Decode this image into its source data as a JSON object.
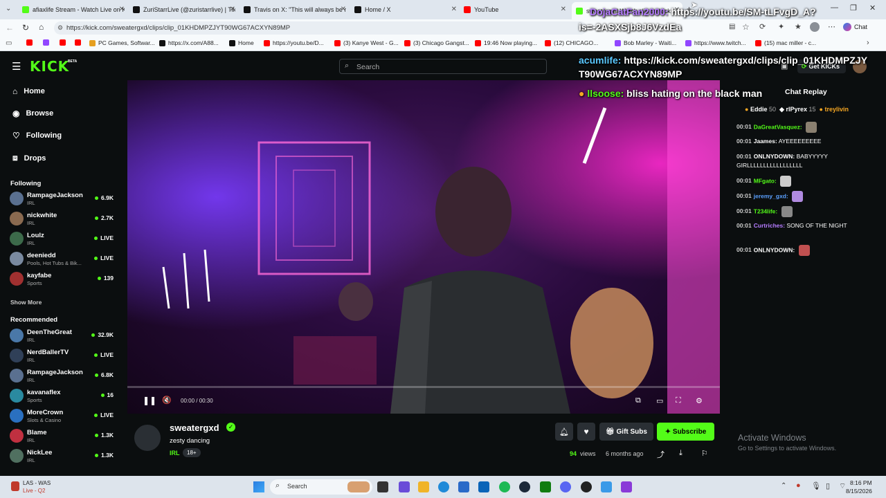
{
  "browser": {
    "tabs": [
      {
        "label": "afiaxlife Stream - Watch Live on K",
        "color": "#53fc18"
      },
      {
        "label": "ZuriStarrLive (@zuristarrlive) | TikTo",
        "color": "#111111"
      },
      {
        "label": "Travis on X: \"This will always be my",
        "color": "#111111"
      },
      {
        "label": "Home / X",
        "color": "#111111"
      },
      {
        "label": "YouTube",
        "color": "#ff0000"
      },
      {
        "label": "sweatergxd Watch clip on Kick",
        "color": "#53fc18"
      }
    ],
    "url": "https://kick.com/sweatergxd/clips/clip_01KHDMPZJYT90WG67ACXYN89MP",
    "copilot_label": "Chat",
    "bookmarks": [
      {
        "label": "",
        "color": "#ff0000"
      },
      {
        "label": "",
        "color": "#9146ff"
      },
      {
        "label": "",
        "color": "#ff0000"
      },
      {
        "label": "",
        "color": "#ff0000"
      },
      {
        "label": "PC Games, Softwar...",
        "color": "#e6a020"
      },
      {
        "label": "https://x.com/A88...",
        "color": "#111111"
      },
      {
        "label": "Home",
        "color": "#111111"
      },
      {
        "label": "https://youtu.be/D...",
        "color": "#ff0000"
      },
      {
        "label": "(3) Kanye West - G...",
        "color": "#ff0000"
      },
      {
        "label": "(3) Chicago Gangst...",
        "color": "#ff0000"
      },
      {
        "label": "19:46 Now playing...",
        "color": "#ff0000"
      },
      {
        "label": "(12) CHICAGO...",
        "color": "#ff0000"
      },
      {
        "label": "Bob Marley - Waiti...",
        "color": "#9146ff"
      },
      {
        "label": "https://www.twitch...",
        "color": "#9146ff"
      },
      {
        "label": "(15) mac miller - c...",
        "color": "#ff0000"
      }
    ]
  },
  "kick": {
    "logo": "KICK",
    "logo_badge": "BETA",
    "search_placeholder": "Search",
    "get_kicks": "Get KICKs",
    "nav": [
      {
        "label": "Home",
        "icon": "home-icon"
      },
      {
        "label": "Browse",
        "icon": "compass-icon"
      },
      {
        "label": "Following",
        "icon": "heart-icon"
      },
      {
        "label": "Drops",
        "icon": "drops-icon"
      }
    ],
    "following_title": "Following",
    "following": [
      {
        "name": "RampageJackson",
        "category": "IRL",
        "count": "6.9K",
        "color": "#5a7090"
      },
      {
        "name": "nickwhite",
        "category": "IRL",
        "count": "2.7K",
        "color": "#8a6a50"
      },
      {
        "name": "Loulz",
        "category": "IRL",
        "count": "LIVE",
        "color": "#3c6a4a"
      },
      {
        "name": "deeniedd",
        "category": "Pools, Hot Tubs & Bik...",
        "count": "LIVE",
        "color": "#7a8aa0"
      },
      {
        "name": "kayfabe",
        "category": "Sports",
        "count": "139",
        "color": "#a03030"
      }
    ],
    "show_more": "Show More",
    "recommended_title": "Recommended",
    "recommended": [
      {
        "name": "DeenTheGreat",
        "category": "IRL",
        "count": "32.9K",
        "color": "#4a78a8"
      },
      {
        "name": "NerdBallerTV",
        "category": "IRL",
        "count": "LIVE",
        "color": "#304058"
      },
      {
        "name": "RampageJackson",
        "category": "IRL",
        "count": "6.8K",
        "color": "#5a7090"
      },
      {
        "name": "kavanaflex",
        "category": "Sports",
        "count": "16",
        "color": "#2a8aa0"
      },
      {
        "name": "MoreCrown",
        "category": "Slots & Casino",
        "count": "LIVE",
        "color": "#2a70c0"
      },
      {
        "name": "Blame",
        "category": "IRL",
        "count": "1.3K",
        "color": "#c03040"
      },
      {
        "name": "NickLee",
        "category": "IRL",
        "count": "1.3K",
        "color": "#507060"
      }
    ],
    "player": {
      "time": "00:00 / 00:30",
      "progress": 0.0
    },
    "clip": {
      "channel": "sweatergxd",
      "title": "zesty dancing",
      "category": "IRL",
      "rating": "18+",
      "views": "94",
      "views_label": "views",
      "age": "6 months ago",
      "gift_subs": "Gift Subs",
      "subscribe": "Subscribe"
    },
    "chat": {
      "title": "Chat Replay",
      "leaders": [
        {
          "name": "Eddie",
          "count": "50",
          "color": "#f5a623"
        },
        {
          "name": "rIPyrex",
          "count": "15",
          "color": "#ffffff"
        },
        {
          "name": "treylivin",
          "count": "",
          "color": "#f5a623"
        }
      ],
      "messages": [
        {
          "time": "00:01",
          "user": "DaGreatVasquez:",
          "color": "#53fc18",
          "text": ""
        },
        {
          "time": "00:01",
          "user": "Jaames:",
          "color": "#ffffff",
          "text": "AYEEEEEEEEE"
        },
        {
          "time": "00:01",
          "user": "ONLNYDOWN:",
          "color": "#ffffff",
          "text": "BABYYYYY GIRLLLLLLLLLLLLLLLLL"
        },
        {
          "time": "00:01",
          "user": "MFgato:",
          "color": "#53fc18",
          "text": ""
        },
        {
          "time": "00:01",
          "user": "jeremy_gxd:",
          "color": "#5aa0ff",
          "text": ""
        },
        {
          "time": "00:01",
          "user": "T234life:",
          "color": "#53fc18",
          "text": ""
        },
        {
          "time": "00:01",
          "user": "Curtriches:",
          "color": "#b57cff",
          "text": "SONG OF THE NIGHT"
        },
        {
          "time": "00:01",
          "user": "ONLNYDOWN:",
          "color": "#ffffff",
          "text": ""
        }
      ]
    }
  },
  "overlay": {
    "line1_user": "DojaCatFan2000:",
    "line1_text": "https://youtu.be/SM-tLFvgD_A?",
    "line1b_text": "is=-2ASXSjb8J6VzdEa",
    "line2_user": "acumlife:",
    "line2_text": "https://kick.com/sweatergxd/clips/clip_01KHDMPZJY",
    "line2b_text": "T90WG67ACXYN89MP",
    "line3_user": "llsoose:",
    "line3_text": "bliss hating on the black man"
  },
  "windows": {
    "activate_title": "Activate Windows",
    "activate_sub": "Go to Settings to activate Windows.",
    "weather_title": "LAS - WAS",
    "weather_sub": "Live - Q2",
    "search": "Search",
    "time": "8:16 PM",
    "date": "8/15/2026"
  }
}
